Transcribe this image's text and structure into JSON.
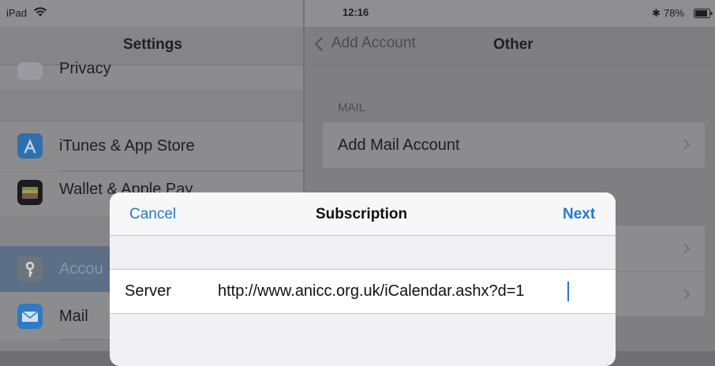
{
  "status_bar": {
    "device": "iPad",
    "time": "12:16",
    "battery": "78%"
  },
  "settings": {
    "title": "Settings",
    "items": [
      {
        "label": "Privacy",
        "icon": "privacy-hand-icon"
      },
      {
        "label": "iTunes & App Store",
        "icon": "app-store-icon"
      },
      {
        "label": "Wallet & Apple Pay",
        "icon": "wallet-icon"
      },
      {
        "label": "Accou",
        "icon": "accounts-key-icon"
      },
      {
        "label": "Mail",
        "icon": "mail-icon"
      }
    ]
  },
  "detail": {
    "back_label": "Add Account",
    "title": "Other",
    "section_header": "MAIL",
    "rows": [
      {
        "label": "Add Mail Account"
      }
    ]
  },
  "modal": {
    "cancel_label": "Cancel",
    "title": "Subscription",
    "next_label": "Next",
    "server_label": "Server",
    "server_value": "http://www.anicc.org.uk/iCalendar.ashx?d=1"
  },
  "colors": {
    "accent": "#2478d3",
    "modal_bg": "#efeff4"
  }
}
